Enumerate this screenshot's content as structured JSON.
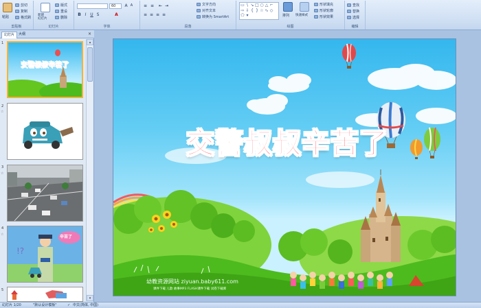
{
  "ribbon": {
    "clipboard": {
      "paste": "粘贴",
      "cut": "剪切",
      "copy": "复制",
      "format_painter": "格式刷",
      "group": "剪贴板"
    },
    "slides": {
      "new_slide": "新建\n幻灯片",
      "layout": "版式",
      "reset": "重设",
      "delete": "删除",
      "group": "幻灯片"
    },
    "font": {
      "size": "60",
      "group": "字体"
    },
    "paragraph": {
      "text_direction": "文字方向",
      "align_text": "对齐文本",
      "smartart": "转换为 SmartArt",
      "group": "段落"
    },
    "drawing": {
      "arrange": "排列",
      "quick_styles": "快速样式",
      "shape_fill": "形状填充",
      "shape_outline": "形状轮廓",
      "shape_effects": "形状效果",
      "group": "绘图"
    },
    "editing": {
      "find": "查找",
      "replace": "替换",
      "select": "选择",
      "group": "编辑"
    }
  },
  "panel": {
    "tabs": [
      "幻灯片",
      "大纲"
    ],
    "slides": [
      {
        "num": "1",
        "selected": true
      },
      {
        "num": "2",
        "selected": false
      },
      {
        "num": "3",
        "selected": false
      },
      {
        "num": "4",
        "selected": false
      },
      {
        "num": "5",
        "selected": false
      }
    ],
    "thumb1_title": "交警叔叔辛苦了",
    "thumb4_bubble": "辛苦了"
  },
  "slide": {
    "title": "交警叔叔辛苦了",
    "watermark": "幼教资源网站  ziyuan.baby611.com",
    "watermark_small": "课件下载 儿歌 故事MP3 FLASH课件下载 试卷下载库"
  },
  "status": {
    "slide_pos": "幻灯片 1/20",
    "theme": "\"默认设计模板\"",
    "language": "中文(简体, 中国)"
  },
  "colors": {
    "title_red": "#ff2e3a",
    "sky": "#34b7ee",
    "grass": "#4dbb1e",
    "ribbon_bg": "#dbe7f7"
  }
}
